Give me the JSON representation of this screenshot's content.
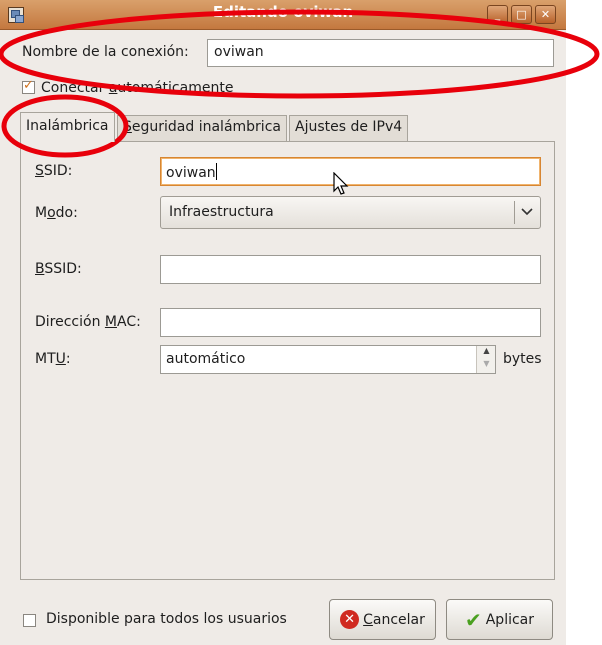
{
  "window": {
    "title": "Editando oviwan",
    "minimize_glyph": "_",
    "maximize_glyph": "□",
    "close_glyph": "✕"
  },
  "connection": {
    "name_label": "Nombre de la conexión:",
    "name_value": "oviwan",
    "auto_connect_label_pre": "C",
    "auto_connect_label_mid": "onectar ",
    "auto_connect_label_u": "a",
    "auto_connect_label_post": "utomáticamente",
    "auto_connect_checked": true
  },
  "tabs": [
    {
      "label": "Inalámbrica",
      "active": true
    },
    {
      "label_u": "S",
      "label_rest": "eguridad inalámbrica",
      "active": false
    },
    {
      "label": "Ajustes de IPv4",
      "active": false
    }
  ],
  "wireless": {
    "ssid_label_u": "S",
    "ssid_label_rest": "SID:",
    "ssid_value": "oviwan",
    "mode_label_pre": "M",
    "mode_label_u": "o",
    "mode_label_rest": "do:",
    "mode_value": "Infraestructura",
    "bssid_label_u": "B",
    "bssid_label_rest": "SSID:",
    "bssid_value": "",
    "mac_label_pre": "Dirección ",
    "mac_label_u": "M",
    "mac_label_rest": "AC:",
    "mac_value": "",
    "mtu_label_pre": "MT",
    "mtu_label_u": "U",
    "mtu_label_rest": ":",
    "mtu_value": "automático",
    "mtu_unit": "bytes"
  },
  "footer": {
    "all_users_label": "Disponible para todos los usuarios",
    "all_users_checked": false,
    "cancel_u": "C",
    "cancel_rest": "ancelar",
    "apply_label": "Aplicar"
  },
  "colors": {
    "titlebar": "#c4783f",
    "annotation": "#e8000b",
    "focus": "#d78632"
  }
}
